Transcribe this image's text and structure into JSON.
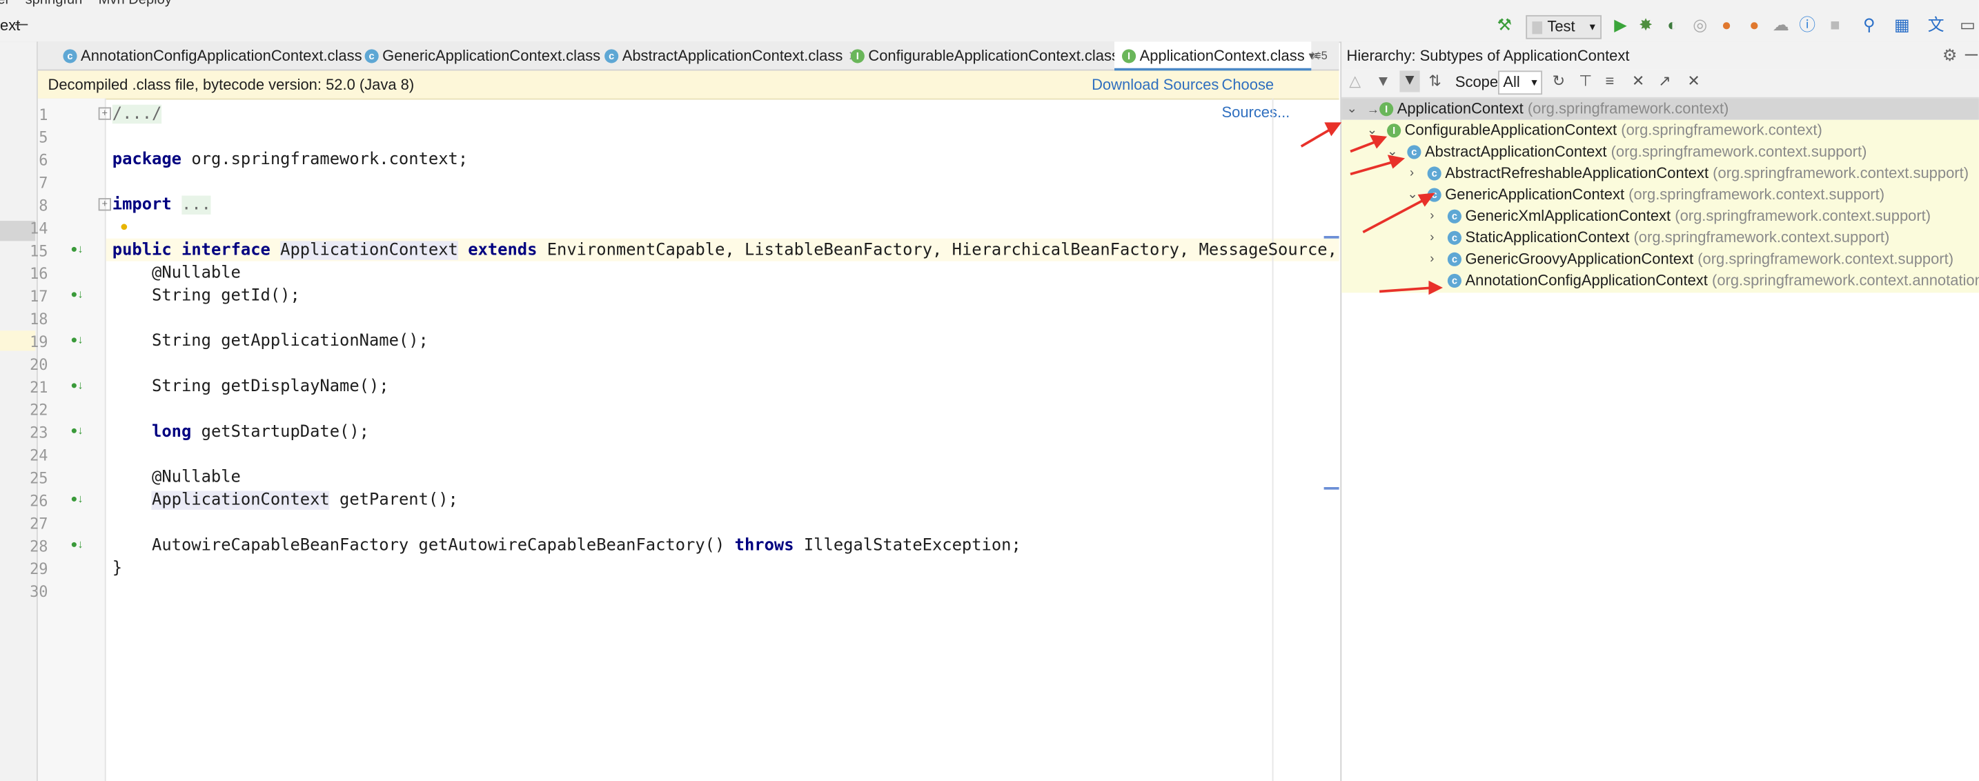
{
  "menubar": {
    "items": [
      "er",
      "springfun",
      "Mvn Deploy"
    ]
  },
  "toolbar": {
    "left_text": "ext",
    "run_config": "Test"
  },
  "tabs": [
    {
      "label": "AnnotationConfigApplicationContext.class",
      "kind": "C"
    },
    {
      "label": "GenericApplicationContext.class",
      "kind": "C"
    },
    {
      "label": "AbstractApplicationContext.class",
      "kind": "C"
    },
    {
      "label": "ConfigurableApplicationContext.class",
      "kind": "I"
    },
    {
      "label": "ApplicationContext.class",
      "kind": "I",
      "active": true
    }
  ],
  "tab_overflow": "5",
  "banner": {
    "text": "Decompiled .class file, bytecode version: 52.0 (Java 8)",
    "download": "Download Sources",
    "choose": "Choose Sources..."
  },
  "editor": {
    "line_numbers": [
      "1",
      "5",
      "6",
      "7",
      "8",
      "14",
      "15",
      "16",
      "17",
      "18",
      "19",
      "20",
      "21",
      "22",
      "23",
      "24",
      "25",
      "26",
      "27",
      "28",
      "29",
      "30"
    ],
    "lines": {
      "l1": "/.../",
      "l6_kw": "package",
      "l6_rest": " org.springframework.context;",
      "l8_kw": "import",
      "l8_rest": "...",
      "l15_kw1": "public",
      "l15_kw2": "interface",
      "l15_name": "ApplicationContext",
      "l15_kw3": "extends",
      "l15_rest": " EnvironmentCapable, ListableBeanFactory, HierarchicalBeanFactory, MessageSource, A",
      "l16": "    @Nullable",
      "l17": "    String getId();",
      "l19": "    String getApplicationName();",
      "l21": "    String getDisplayName();",
      "l23_kw": "long",
      "l23_rest": " getStartupDate();",
      "l25": "    @Nullable",
      "l26_name": "ApplicationContext",
      "l26_rest": " getParent();",
      "l28_a": "    AutowireCapableBeanFactory getAutowireCapableBeanFactory() ",
      "l28_kw": "throws",
      "l28_b": " IllegalStateException;",
      "l29": "}"
    }
  },
  "hierarchy": {
    "title": "Hierarchy:  Subtypes of ApplicationContext",
    "scope_label": "Scope:",
    "scope_value": "All",
    "nodes": [
      {
        "name": "ApplicationContext",
        "pkg": "(org.springframework.context)",
        "kind": "I"
      },
      {
        "name": "ConfigurableApplicationContext",
        "pkg": "(org.springframework.context)",
        "kind": "I"
      },
      {
        "name": "AbstractApplicationContext",
        "pkg": "(org.springframework.context.support)",
        "kind": "C"
      },
      {
        "name": "AbstractRefreshableApplicationContext",
        "pkg": "(org.springframework.context.support)",
        "kind": "C"
      },
      {
        "name": "GenericApplicationContext",
        "pkg": "(org.springframework.context.support)",
        "kind": "C"
      },
      {
        "name": "GenericXmlApplicationContext",
        "pkg": "(org.springframework.context.support)",
        "kind": "C"
      },
      {
        "name": "StaticApplicationContext",
        "pkg": "(org.springframework.context.support)",
        "kind": "C"
      },
      {
        "name": "GenericGroovyApplicationContext",
        "pkg": "(org.springframework.context.support)",
        "kind": "C"
      },
      {
        "name": "AnnotationConfigApplicationContext",
        "pkg": "(org.springframework.context.annotation)",
        "kind": "C"
      }
    ]
  },
  "colors": {
    "accent": "#4a88c7",
    "annotation_arrow": "#e8312a",
    "tree_highlight": "#fbfbdc"
  }
}
